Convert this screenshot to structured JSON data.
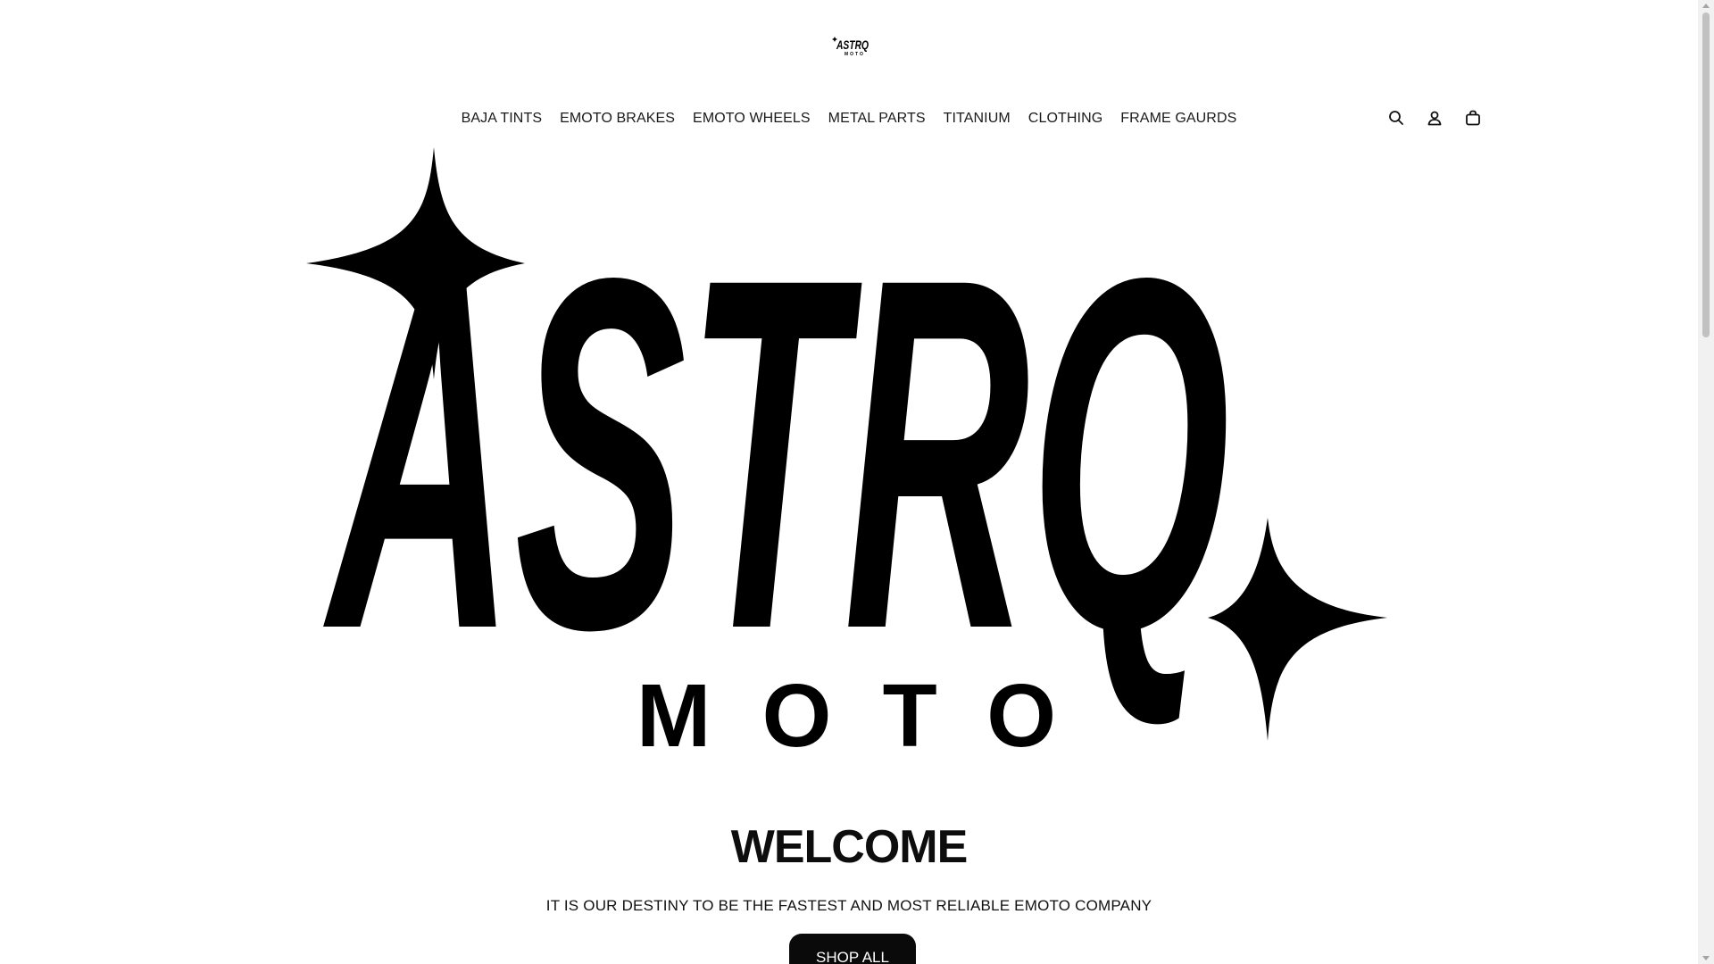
{
  "brand": {
    "logo_text": "ASTRQ",
    "logo_subtext": "MOTO"
  },
  "nav": {
    "items": [
      {
        "label": "BAJA TINTS"
      },
      {
        "label": "EMOTO BRAKES"
      },
      {
        "label": "EMOTO WHEELS"
      },
      {
        "label": "METAL PARTS"
      },
      {
        "label": "TITANIUM"
      },
      {
        "label": "CLOTHING"
      },
      {
        "label": "FRAME GAURDS"
      }
    ]
  },
  "header_icons": [
    "search-icon",
    "account-icon",
    "cart-icon"
  ],
  "hero": {
    "title": "WELCOME",
    "subtitle": "IT IS OUR DESTINY TO BE THE FASTEST AND MOST RELIABLE EMOTO COMPANY",
    "button_label": "SHOP ALL"
  },
  "colors": {
    "text": "#111111",
    "button_bg": "#0a0a0a",
    "button_text": "#ffffff",
    "background": "#ffffff"
  }
}
